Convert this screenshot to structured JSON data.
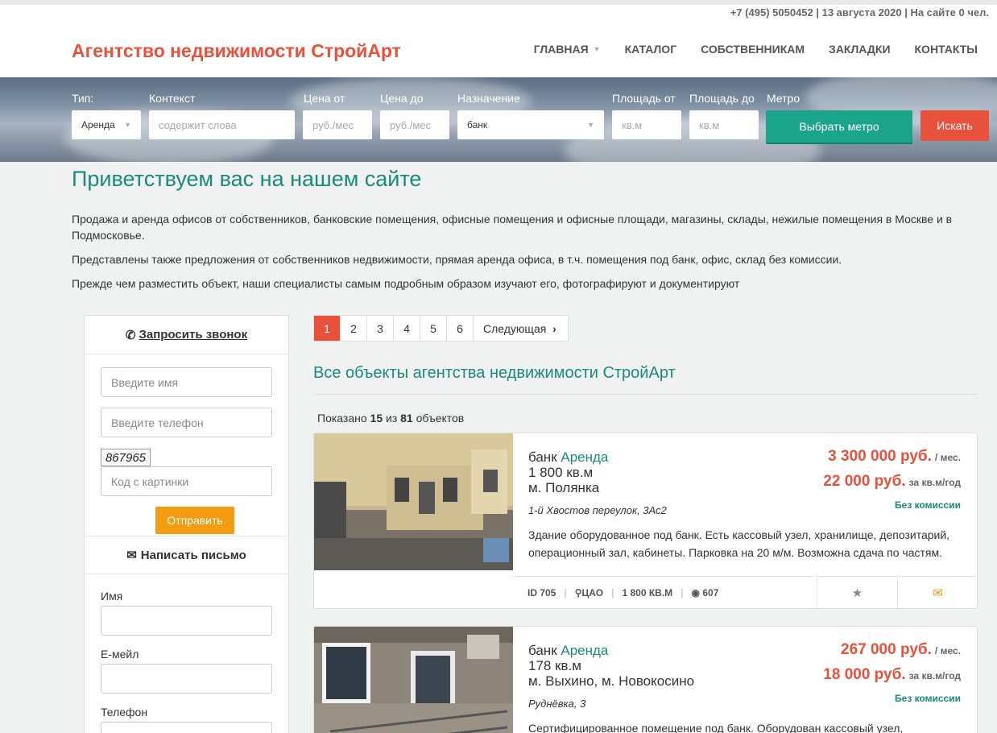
{
  "topinfo": "+7 (495) 5050452 | 13 августа 2020 | На сайте 0 чел.",
  "logo": "Агентство недвижимости СтройАрт",
  "nav": {
    "home": "ГЛАВНАЯ",
    "catalog": "КАТАЛОГ",
    "owners": "СОБСТВЕННИКАМ",
    "bookmarks": "ЗАКЛАДКИ",
    "contacts": "КОНТАКТЫ"
  },
  "search": {
    "type_label": "Тип:",
    "type_value": "Аренда",
    "context_label": "Контекст",
    "context_ph": "содержит слова",
    "price_from_label": "Цена от",
    "price_from_ph": "руб./мес",
    "price_to_label": "Цена до",
    "price_to_ph": "руб./мес",
    "purpose_label": "Назначение",
    "purpose_value": "банк",
    "area_from_label": "Площадь от",
    "area_from_ph": "кв.м",
    "area_to_label": "Площадь до",
    "area_to_ph": "кв.м",
    "metro_label": "Метро",
    "metro_button": "Выбрать метро",
    "find_button": "Искать"
  },
  "welcome": "Приветствуем вас на нашем сайте",
  "intro": [
    "Продажа и аренда офисов от собственников, банковские помещения, офисные помещения и офисные площади, магазины, склады, нежилые помещения в Москве и в Подмосковье.",
    "Представлены также предложения от собственников недвижимости, прямая аренда офиса, в т.ч. помещения под банк, офис, склад без комиссии.",
    "Прежде чем разместить объект, наши специалисты самым подробным образом изучают его, фотографируют и документируют"
  ],
  "callback": {
    "title": "Запросить звонок",
    "name_ph": "Введите имя",
    "phone_ph": "Введите телефон",
    "captcha": "867965",
    "code_ph": "Код с картинки",
    "send": "Отправить"
  },
  "letter": {
    "title": "Написать письмо",
    "name_label": "Имя",
    "email_label": "Е-мейл",
    "phone_label": "Телефон"
  },
  "pagination": {
    "pages": [
      "1",
      "2",
      "3",
      "4",
      "5",
      "6"
    ],
    "next": "Следующая"
  },
  "list_title": "Все объекты агентства недвижимости СтройАрт",
  "shown": {
    "prefix": "Показано",
    "count": "15",
    "mid": "из",
    "total": "81",
    "suffix": "объектов"
  },
  "listings": [
    {
      "kind": "банк",
      "deal": "Аренда",
      "area": "1 800 кв.м",
      "metro": "м. Полянка",
      "address": "1-й Хвостов переулок, 3Ас2",
      "description": "Здание оборудованное под банк. Есть кассовый узел, хранилище, депозитарий, операционный зал, кабинеты. Парковка на 20 м/м. Возможна сдача по частям.",
      "price1": "3 300 000 руб.",
      "price1_unit": "/ мес.",
      "price2": "22 000 руб.",
      "price2_unit": "за кв.м/год",
      "commission": "Без комиссии",
      "id": "ID 705",
      "district": "ЦАО",
      "area_upper": "1 800 КВ.М",
      "views": "607"
    },
    {
      "kind": "банк",
      "deal": "Аренда",
      "area": "178 кв.м",
      "metro": "м. Выхино, м. Новокосино",
      "address": "Руднёвка, 3",
      "description": "Сертифицированное помещение под банк. Оборудован кассовый узел,",
      "price1": "267 000 руб.",
      "price1_unit": "/ мес.",
      "price2": "18 000 руб.",
      "price2_unit": "за кв.м/год",
      "commission": "Без комиссии"
    }
  ],
  "colors": {
    "accent": "#e8513b",
    "teal": "#1a8a7a",
    "metro_btn": "#1aa58b",
    "send_btn": "#f39c12"
  }
}
